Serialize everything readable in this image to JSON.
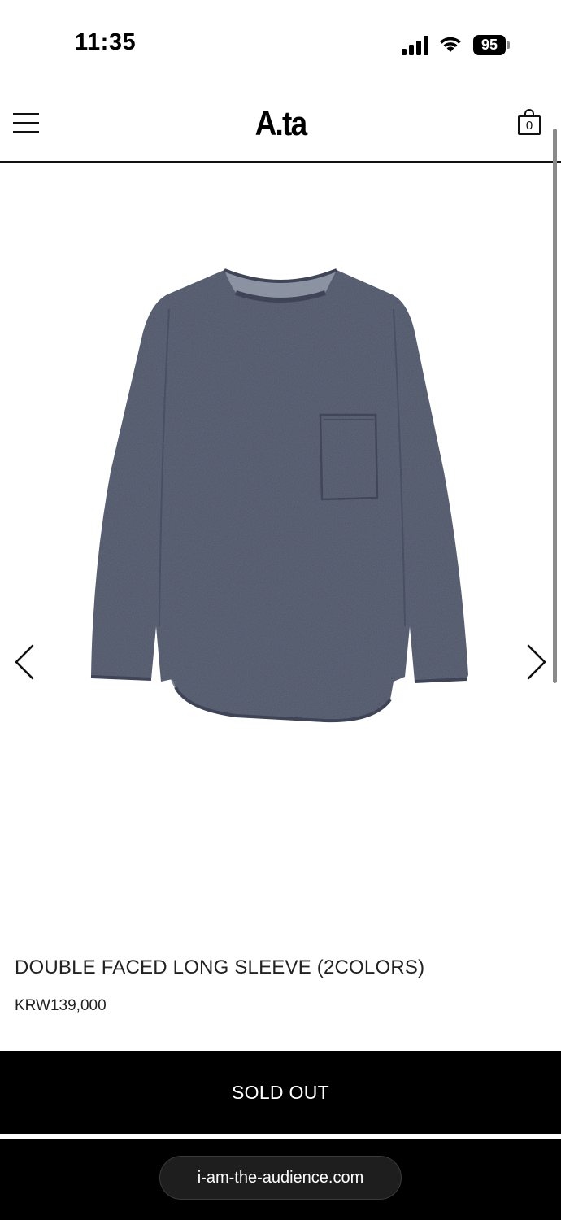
{
  "status_bar": {
    "time": "11:35",
    "battery": "95",
    "icons": [
      "signal-icon",
      "wifi-icon",
      "battery-icon"
    ]
  },
  "header": {
    "brand": "A.ta",
    "cart_count": "0",
    "icons": [
      "menu-icon",
      "shopping-bag-icon"
    ]
  },
  "gallery": {
    "image": "navy-long-sleeve-shirt",
    "prev_icon": "chevron-left-icon",
    "next_icon": "chevron-right-icon",
    "shirt_color": "#4b5265"
  },
  "product": {
    "title": "DOUBLE FACED LONG SLEEVE (2COLORS)",
    "price": "KRW139,000",
    "status_button": "SOLD OUT"
  },
  "browser": {
    "url": "i-am-the-audience.com"
  }
}
